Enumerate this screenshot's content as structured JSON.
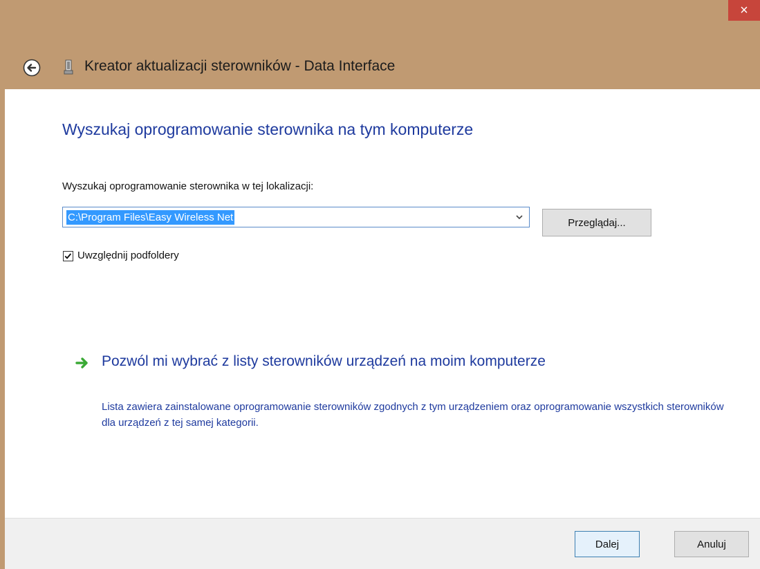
{
  "window": {
    "title": "Kreator aktualizacji sterowników - Data Interface",
    "close_symbol": "×"
  },
  "main": {
    "heading": "Wyszukaj oprogramowanie sterownika na tym komputerze",
    "location_label": "Wyszukaj oprogramowanie sterownika w tej lokalizacji:",
    "location_value": "C:\\Program Files\\Easy Wireless Net",
    "browse_label": "Przeglądaj...",
    "include_subfolders_label": "Uwzględnij podfoldery",
    "include_subfolders_checked": true,
    "pick_option_title": "Pozwól mi wybrać z listy sterowników urządzeń na moim komputerze",
    "pick_option_description": "Lista zawiera zainstalowane oprogramowanie sterowników zgodnych z tym urządzeniem oraz oprogramowanie wszystkich sterowników dla urządzeń z tej samej kategorii."
  },
  "footer": {
    "next_label": "Dalej",
    "cancel_label": "Anuluj"
  },
  "icons": {
    "back": "back-arrow-icon",
    "device": "device-icon",
    "dropdown": "chevron-down-icon",
    "option": "green-arrow-icon"
  },
  "colors": {
    "title_bar": "#c09a72",
    "close_button": "#c7453b",
    "link_text": "#1e3a9e",
    "selection": "#3399ff",
    "option_arrow": "#3aa935"
  }
}
